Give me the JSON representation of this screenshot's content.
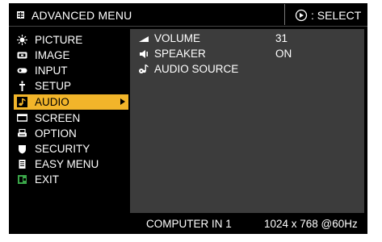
{
  "header": {
    "title": "ADVANCED MENU",
    "select_hint": ": SELECT"
  },
  "menu": {
    "items": [
      {
        "label": "PICTURE",
        "icon": "picture-icon"
      },
      {
        "label": "IMAGE",
        "icon": "image-icon"
      },
      {
        "label": "INPUT",
        "icon": "input-icon"
      },
      {
        "label": "SETUP",
        "icon": "setup-icon"
      },
      {
        "label": "AUDIO",
        "icon": "audio-icon",
        "selected": true
      },
      {
        "label": "SCREEN",
        "icon": "screen-icon"
      },
      {
        "label": "OPTION",
        "icon": "option-icon"
      },
      {
        "label": "SECURITY",
        "icon": "security-icon"
      },
      {
        "label": "EASY MENU",
        "icon": "easy-menu-icon"
      },
      {
        "label": "EXIT",
        "icon": "exit-icon"
      }
    ]
  },
  "audio": {
    "items": [
      {
        "label": "VOLUME",
        "value": "31",
        "icon": "volume-icon"
      },
      {
        "label": "SPEAKER",
        "value": "ON",
        "icon": "speaker-icon"
      },
      {
        "label": "AUDIO SOURCE",
        "value": "",
        "icon": "audio-source-icon"
      }
    ]
  },
  "status": {
    "source": "COMPUTER IN 1",
    "resolution": "1024 x 768 @60Hz"
  },
  "colors": {
    "background": "#000000",
    "panel": "#3c3c3c",
    "highlight": "#f2b52a",
    "text": "#ffffff"
  }
}
